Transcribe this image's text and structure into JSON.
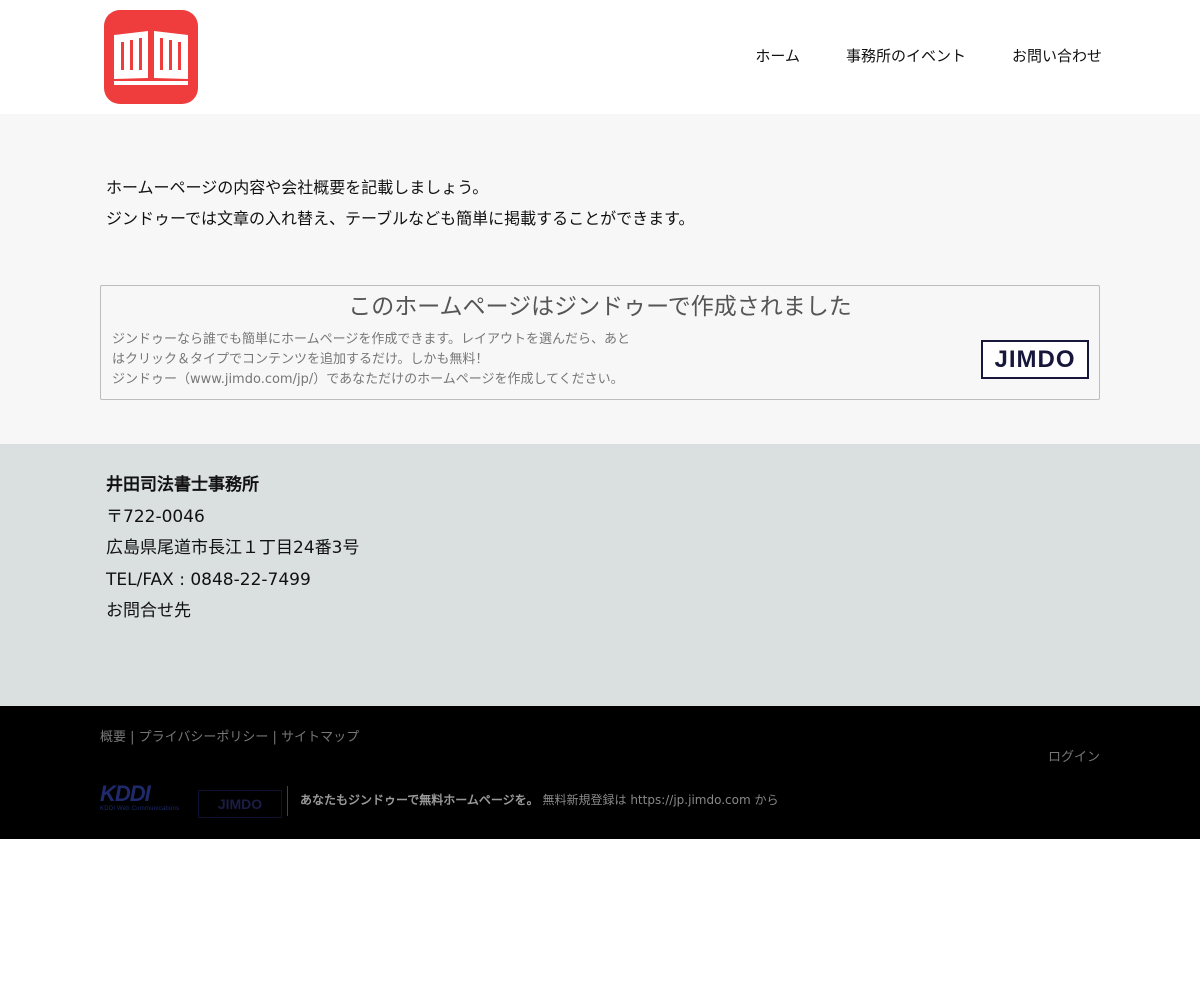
{
  "header": {
    "logo_icon": "open-book-icon",
    "logo_color": "#ef3c3c",
    "nav": [
      {
        "label": "ホーム"
      },
      {
        "label": "事務所のイベント"
      },
      {
        "label": "お問い合わせ"
      }
    ]
  },
  "main": {
    "intro_lines": [
      "ホームーページの内容や会社概要を記載しましょう。",
      "ジンドゥーでは文章の入れ替え、テーブルなども簡単に掲載することができます。"
    ]
  },
  "promo": {
    "title": "このホームページはジンドゥーで作成されました",
    "description_lines": [
      "ジンドゥーなら誰でも簡単にホームページを作成できます。レイアウトを選んだら、あと",
      "はクリック＆タイプでコンテンツを追加するだけ。しかも無料！",
      "ジンドゥー（www.jimdo.com/jp/）であなただけのホームページを作成してください。"
    ],
    "logo_text": "JIMDO"
  },
  "info": {
    "name": "井田司法書士事務所",
    "postal": "〒722-0046",
    "address": "広島県尾道市長江１丁目24番3号",
    "tel": "TEL/FAX : 0848-22-7499",
    "contact": "お問合せ先"
  },
  "footer": {
    "links": [
      {
        "label": "概要"
      },
      {
        "label": "プライバシーポリシー"
      },
      {
        "label": "サイトマップ"
      }
    ],
    "separator": " | ",
    "login": "ログイン",
    "kddi_logo": "KDDI",
    "kddi_sub": "KDDI Web Communications",
    "jimdo_small": "JIMDO",
    "promo_bold": "あなたもジンドゥーで無料ホームページを。",
    "promo_text": " 無料新規登録は ",
    "promo_link": "https://jp.jimdo.com",
    "promo_suffix": " から"
  },
  "colors": {
    "main_bg": "#f7f7f7",
    "info_bg": "#dadfdf",
    "footer_bg": "#000000"
  }
}
